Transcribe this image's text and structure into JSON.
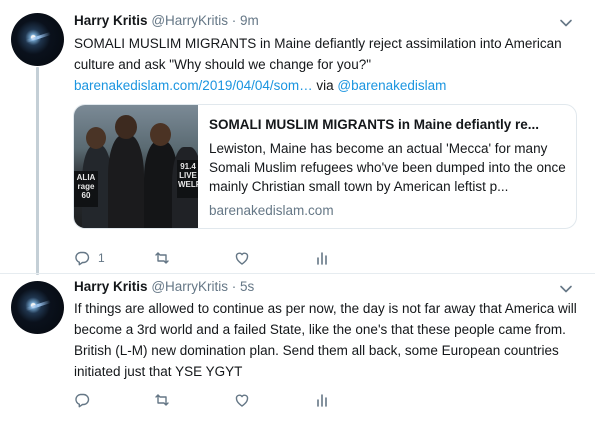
{
  "colors": {
    "link": "#1b95e0",
    "secondary_text": "#657786",
    "thread_line": "#c4cfd6"
  },
  "tweets": [
    {
      "name": "Harry Kritis",
      "handle": "@HarryKritis",
      "separator": "·",
      "time": "9m",
      "text_1": "SOMALI MUSLIM MIGRANTS in Maine defiantly reject assimilation into American culture and ask \"Why should we change for you?\" ",
      "link_text": "barenakedislam.com/2019/04/04/som…",
      "text_2": " via ",
      "mention": "@barenakedislam",
      "card": {
        "title": "SOMALI MUSLIM MIGRANTS in Maine defiantly re...",
        "description": "Lewiston, Maine has become an actual 'Mecca' for many Somali Muslim refugees who've been dumped into the once mainly Christian small town by American leftist p...",
        "domain": "barenakedislam.com",
        "image_sign_1": "91.4 LIVE WELF",
        "image_sign_2": "ALIA rage 60"
      },
      "actions": {
        "reply_count": "1",
        "retweet_count": "",
        "like_count": ""
      }
    },
    {
      "name": "Harry Kritis",
      "handle": "@HarryKritis",
      "separator": "·",
      "time": "5s",
      "text": "If things are allowed to continue as per now, the day is not far away that America will become a 3rd world and a failed State, like the one's that these people came from. British (L-M) new domination plan. Send them all back, some European countries initiated just that YSE YGYT",
      "actions": {
        "reply_count": "",
        "retweet_count": "",
        "like_count": ""
      }
    }
  ],
  "icons": {
    "caret": "chevron-down-icon",
    "reply": "reply-icon",
    "retweet": "retweet-icon",
    "like": "heart-icon",
    "analytics": "analytics-icon"
  }
}
